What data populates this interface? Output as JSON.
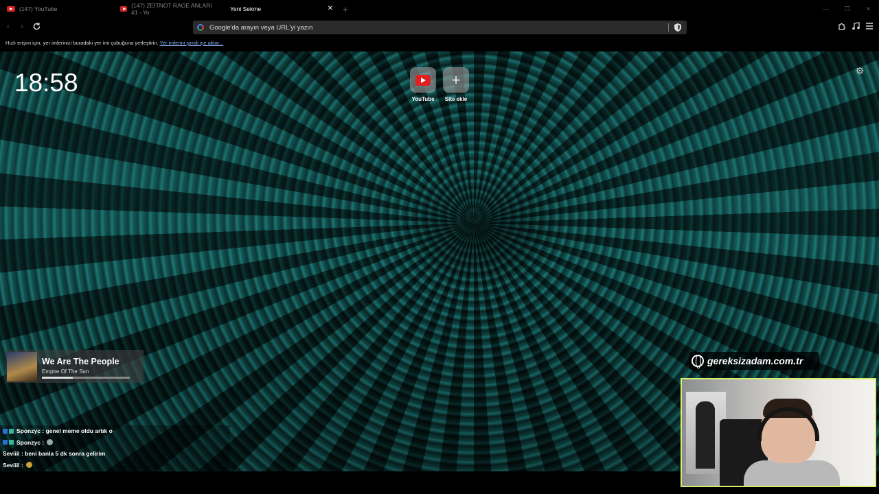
{
  "tabs": [
    {
      "title": "(147) YouTube",
      "active": false
    },
    {
      "title": "(147) ZEİTNOT RAGE ANLARI #1 - Yo",
      "active": false
    },
    {
      "title": "Yeni Sekme",
      "active": true
    }
  ],
  "omnibox": {
    "placeholder": "Google'da arayın veya URL'yi yazın"
  },
  "bookmark_bar": {
    "text": "Hızlı erişim için, yer imlerinizi buradaki yer imi çubuğuna yerleştirin.",
    "link": "Yer imlerini şimdi içe aktar..."
  },
  "clock": "18:58",
  "shortcuts": [
    {
      "label": "YouTube",
      "icon": "youtube-icon"
    },
    {
      "label": "Site ekle",
      "icon": "plus-icon"
    }
  ],
  "now_playing": {
    "title": "We Are The People",
    "artist": "Empire Of The Sun",
    "progress": 0.35
  },
  "site_badge": "gereksizadam.com.tr",
  "chat": [
    {
      "user": "Sponzyc",
      "message": "genel meme oldu artık o",
      "badges": true
    },
    {
      "user": "Sponzyc",
      "message": "",
      "badges": true
    },
    {
      "user": "Seviiil",
      "message": "beni banla 5 dk sonra gelirim",
      "badges": false
    },
    {
      "user": "Seviiil",
      "message": "",
      "badges": false
    }
  ]
}
